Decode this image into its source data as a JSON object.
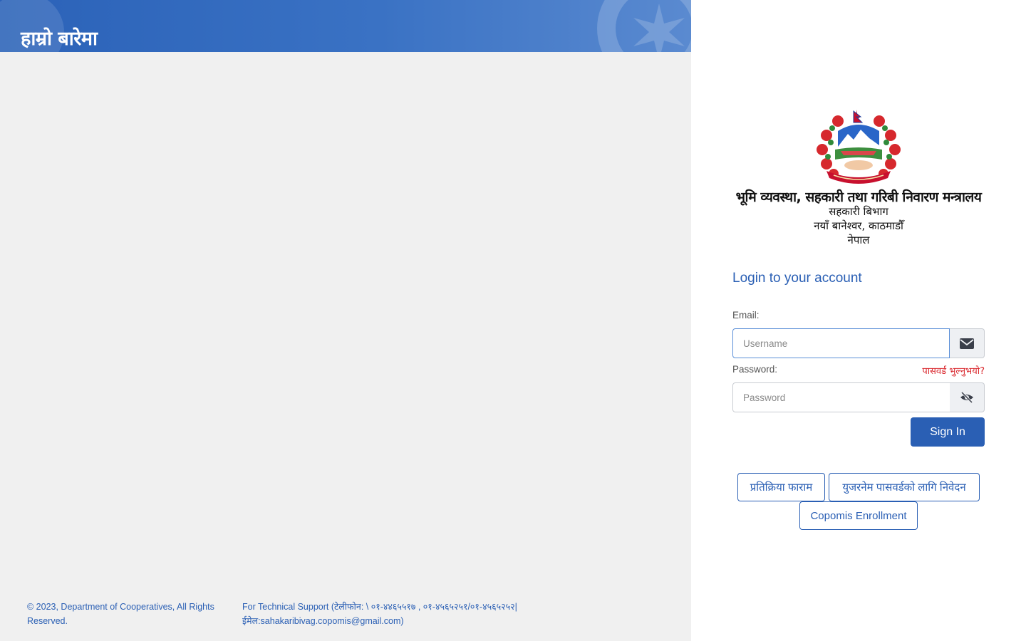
{
  "banner": {
    "title": "हाम्रो बारेमा"
  },
  "footer": {
    "copyright": "© 2023, Department of Cooperatives, All Rights Reserved.",
    "support": "For Technical Support (टेलीफोन: \\ ०१-४४६५५१७ , ०१-४५६५२५१/०१-४५६५२५२| ईमेल:sahakaribivag.copomis@gmail.com)"
  },
  "org": {
    "ministry": "भूमि व्यवस्था, सहकारी तथा गरिबी निवारण मन्त्रालय",
    "department": "सहकारी बिभाग",
    "address": "नयाँ बानेश्वर, काठमाडौँ",
    "country": "नेपाल"
  },
  "login": {
    "title": "Login to your account",
    "email_label": "Email:",
    "username_placeholder": "Username",
    "username_value": "",
    "password_label": "Password:",
    "password_placeholder": "Password",
    "password_value": "",
    "forgot_link": "पासवर्ड भुल्नुभयो?",
    "signin_label": "Sign In"
  },
  "links": {
    "feedback": "प्रतिक्रिया फाराम",
    "username_password_request": "युजरनेम पासवर्डको लागि निवेदन",
    "enrollment": "Copomis Enrollment"
  },
  "icons": {
    "email_addon": "envelope-icon",
    "password_addon": "eye-slash-icon",
    "emblem": "nepal-emblem"
  },
  "colors": {
    "primary": "#2a5fb4",
    "danger": "#d9262c",
    "left_bg": "#f0f0f0"
  }
}
